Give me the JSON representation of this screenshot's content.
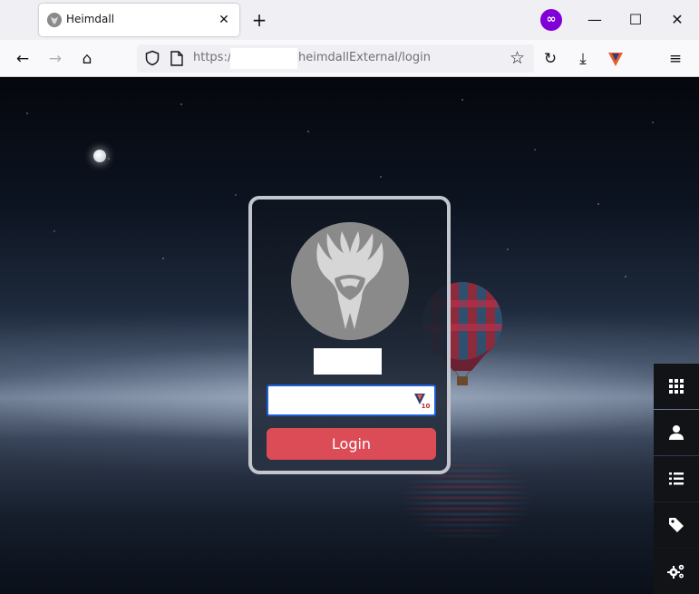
{
  "browser": {
    "tab_title": "Heimdall",
    "tab_close_glyph": "✕",
    "new_tab_glyph": "+",
    "private_icon": "private-browsing-mask-icon",
    "private_glyph": "∞",
    "window_controls": {
      "minimize_glyph": "—",
      "maximize_glyph": "☐",
      "close_glyph": "✕"
    },
    "nav": {
      "back_glyph": "←",
      "forward_glyph": "→",
      "home_glyph": "⌂",
      "reload_glyph": "↻",
      "download_glyph": "⤓",
      "menu_glyph": "≡",
      "bookmark_glyph": "☆"
    },
    "url": {
      "prefix": "https:/",
      "path": "heimdallExternal/login"
    },
    "colors": {
      "private_purple": "#8000d7",
      "focus_blue": "#1e5ed8"
    }
  },
  "login": {
    "password_value": "",
    "login_label": "Login",
    "button_color": "#dc4c57"
  },
  "side_menu": {
    "items": [
      {
        "icon": "grid-apps-icon"
      },
      {
        "icon": "user-icon"
      },
      {
        "icon": "list-icon"
      },
      {
        "icon": "tag-icon"
      },
      {
        "icon": "settings-gears-icon"
      }
    ]
  }
}
